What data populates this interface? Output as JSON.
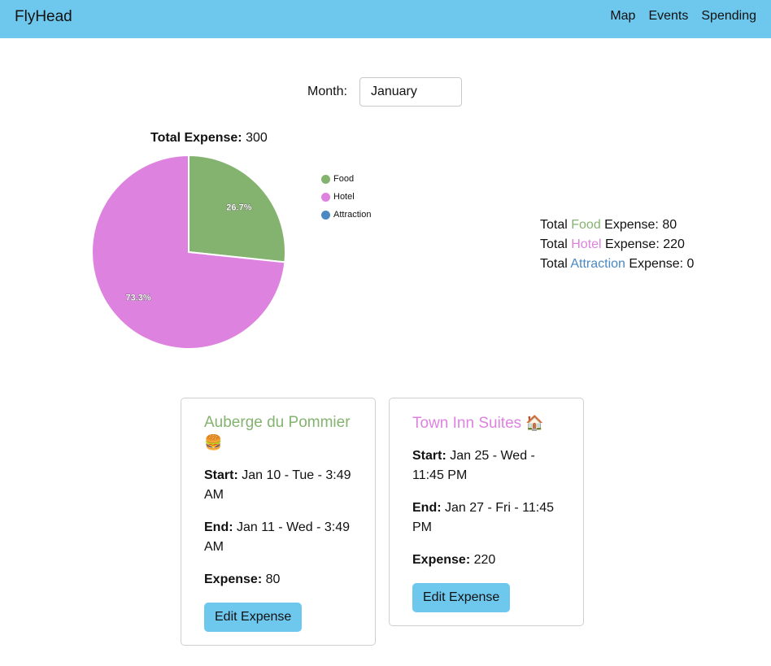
{
  "navbar": {
    "brand": "FlyHead",
    "links": [
      "Map",
      "Events",
      "Spending"
    ]
  },
  "month": {
    "label": "Month:",
    "selected": "January"
  },
  "summary": {
    "total_label": "Total Expense:",
    "total_value": "300"
  },
  "colors": {
    "nav": "#6ec8ee",
    "food": "#84b36f",
    "hotel": "#de82e0",
    "attraction": "#4a89c2"
  },
  "chart_data": {
    "type": "pie",
    "slices": [
      {
        "label": "Food",
        "value": 80,
        "percent_label": "26.7%",
        "color": "#84b36f"
      },
      {
        "label": "Hotel",
        "value": 220,
        "percent_label": "73.3%",
        "color": "#de82e0"
      },
      {
        "label": "Attraction",
        "value": 0,
        "percent_label": "",
        "color": "#4a89c2"
      }
    ],
    "legend": [
      "Food",
      "Hotel",
      "Attraction"
    ],
    "legend_position": "right"
  },
  "totals": [
    {
      "prefix": "Total ",
      "category": "Food",
      "suffix": " Expense: 80"
    },
    {
      "prefix": "Total ",
      "category": "Hotel",
      "suffix": " Expense: 220"
    },
    {
      "prefix": "Total ",
      "category": "Attraction",
      "suffix": " Expense: 0"
    }
  ],
  "cards": [
    {
      "title": "Auberge du Pommier",
      "emoji": "🍔",
      "start_label": "Start:",
      "start_value": "Jan 10 - Tue - 3:49 AM",
      "end_label": "End:",
      "end_value": "Jan 11 - Wed - 3:49 AM",
      "expense_label": "Expense:",
      "expense_value": "80",
      "button": "Edit Expense"
    },
    {
      "title": "Town Inn Suites",
      "emoji": "🏠",
      "start_label": "Start:",
      "start_value": "Jan 25 - Wed - 11:45 PM",
      "end_label": "End:",
      "end_value": "Jan 27 - Fri - 11:45 PM",
      "expense_label": "Expense:",
      "expense_value": "220",
      "button": "Edit Expense"
    }
  ]
}
